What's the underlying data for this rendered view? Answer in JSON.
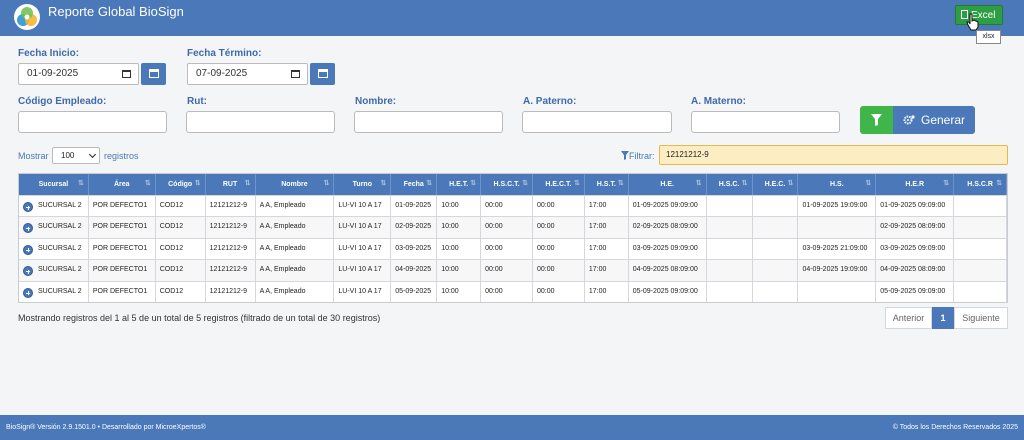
{
  "app": {
    "title": "Reporte Global BioSign"
  },
  "header": {
    "excel_label": "Excel",
    "excel_tooltip": "xlsx"
  },
  "form": {
    "fecha_inicio_label": "Fecha Inicio:",
    "fecha_inicio_value": "01-09-2025",
    "fecha_termino_label": "Fecha Término:",
    "fecha_termino_value": "07-09-2025",
    "codigo_label": "Código Empleado:",
    "rut_label": "Rut:",
    "nombre_label": "Nombre:",
    "paterno_label": "A. Paterno:",
    "materno_label": "A. Materno:",
    "generar_label": "Generar"
  },
  "controls": {
    "mostrar_label": "Mostrar",
    "page_size": "100",
    "registros_label": "registros",
    "filtrar_label": "Filtrar:",
    "filtrar_value": "12121212-9"
  },
  "table": {
    "columns": [
      "Sucursal",
      "Área",
      "Código",
      "RUT",
      "Nombre",
      "Turno",
      "Fecha",
      "H.E.T.",
      "H.S.C.T.",
      "H.E.C.T.",
      "H.S.T.",
      "H.E.",
      "H.S.C.",
      "H.E.C.",
      "H.S.",
      "H.E.R",
      "H.S.C.R"
    ],
    "rows": [
      [
        "SUCURSAL 2",
        "POR DEFECTO1",
        "COD12",
        "12121212-9",
        "A A, Empleado",
        "LU-VI 10 A 17",
        "01-09-2025",
        "10:00",
        "00:00",
        "00:00",
        "17:00",
        "01-09-2025 09:09:00",
        "",
        "",
        "01-09-2025 19:09:00",
        "01-09-2025 09:09:00",
        ""
      ],
      [
        "SUCURSAL 2",
        "POR DEFECTO1",
        "COD12",
        "12121212-9",
        "A A, Empleado",
        "LU-VI 10 A 17",
        "02-09-2025",
        "10:00",
        "00:00",
        "00:00",
        "17:00",
        "02-09-2025 08:09:00",
        "",
        "",
        "",
        "02-09-2025 08:09:00",
        ""
      ],
      [
        "SUCURSAL 2",
        "POR DEFECTO1",
        "COD12",
        "12121212-9",
        "A A, Empleado",
        "LU-VI 10 A 17",
        "03-09-2025",
        "10:00",
        "00:00",
        "00:00",
        "17:00",
        "03-09-2025 09:09:00",
        "",
        "",
        "03-09-2025 21:09:00",
        "03-09-2025 09:09:00",
        ""
      ],
      [
        "SUCURSAL 2",
        "POR DEFECTO1",
        "COD12",
        "12121212-9",
        "A A, Empleado",
        "LU-VI 10 A 17",
        "04-09-2025",
        "10:00",
        "00:00",
        "00:00",
        "17:00",
        "04-09-2025 08:09:00",
        "",
        "",
        "04-09-2025 19:09:00",
        "04-09-2025 08:09:00",
        ""
      ],
      [
        "SUCURSAL 2",
        "POR DEFECTO1",
        "COD12",
        "12121212-9",
        "A A, Empleado",
        "LU-VI 10 A 17",
        "05-09-2025",
        "10:00",
        "00:00",
        "00:00",
        "17:00",
        "05-09-2025 09:09:00",
        "",
        "",
        "",
        "05-09-2025 09:09:00",
        ""
      ]
    ]
  },
  "info": {
    "text": "Mostrando registros del 1 al 5 de un total de 5 registros (filtrado de un total de 30 registros)"
  },
  "pagination": {
    "prev_label": "Anterior",
    "current": "1",
    "next_label": "Siguiente"
  },
  "footer": {
    "left": "BioSign® Versión 2.9.1501.0 • Desarrollado por MicroeXpertos®",
    "right": "© Todos los Derechos Reservados 2025"
  },
  "colors": {
    "primary": "#4a78b8",
    "success": "#3fb54a",
    "excel": "#2e9e44",
    "filter_bg": "#fdedc3"
  }
}
